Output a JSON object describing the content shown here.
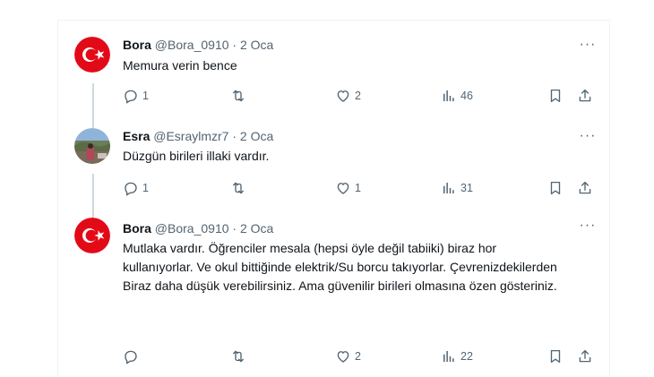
{
  "tweets": [
    {
      "name": "Bora",
      "handle": "@Bora_0910",
      "dot": "·",
      "date": "2 Oca",
      "text": "Memura verin bence",
      "replies": "1",
      "retweets": "",
      "likes": "2",
      "views": "46",
      "avatar": "turkish-flag"
    },
    {
      "name": "Esra",
      "handle": "@Esraylmzr7",
      "dot": "·",
      "date": "2 Oca",
      "text": "Düzgün birileri illaki vardır.",
      "replies": "1",
      "retweets": "",
      "likes": "1",
      "views": "31",
      "avatar": "photo"
    },
    {
      "name": "Bora",
      "handle": "@Bora_0910",
      "dot": "·",
      "date": "2 Oca",
      "text": "Mutlaka vardır. Öğrenciler mesala (hepsi öyle değil tabiiki) biraz hor kullanıyorlar. Ve okul bittiğinde  elektrik/Su borcu takıyorlar. Çevrenizdekilerden Biraz daha düşük verebilirsiniz. Ama güvenilir birileri olmasına özen gösteriniz.",
      "replies": "",
      "retweets": "",
      "likes": "2",
      "views": "22",
      "avatar": "turkish-flag"
    }
  ],
  "colors": {
    "flag_red": "#e30a17",
    "muted": "#536471",
    "thread_line": "#cfd9de"
  },
  "icons": [
    "reply-icon",
    "retweet-icon",
    "like-icon",
    "views-icon",
    "bookmark-icon",
    "share-icon",
    "more-icon"
  ]
}
